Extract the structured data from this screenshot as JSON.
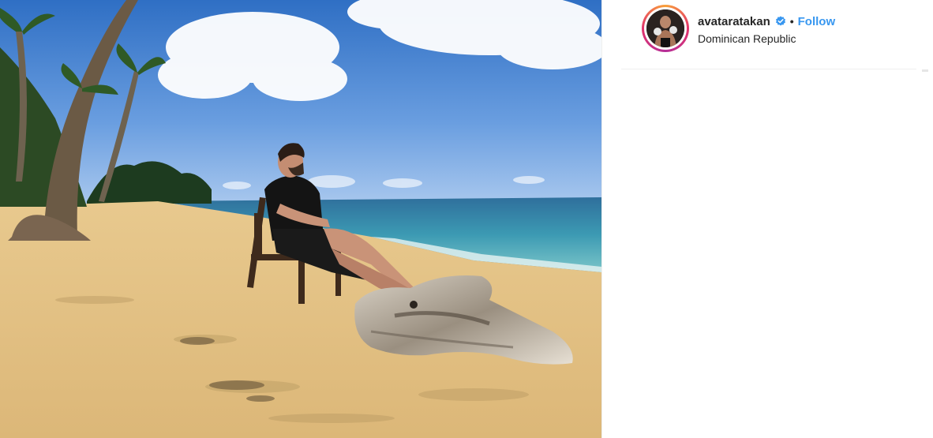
{
  "post": {
    "username": "avataratakan",
    "separator": "•",
    "follow_label": "Follow",
    "location": "Dominican Republic"
  },
  "icons": {
    "verified": "verified-badge-icon",
    "avatar": "profile-avatar"
  },
  "colors": {
    "follow_link": "#3897f0",
    "verified_badge": "#3897f0",
    "story_ring": [
      "#f9a13a",
      "#e2336b",
      "#b52f98"
    ]
  }
}
